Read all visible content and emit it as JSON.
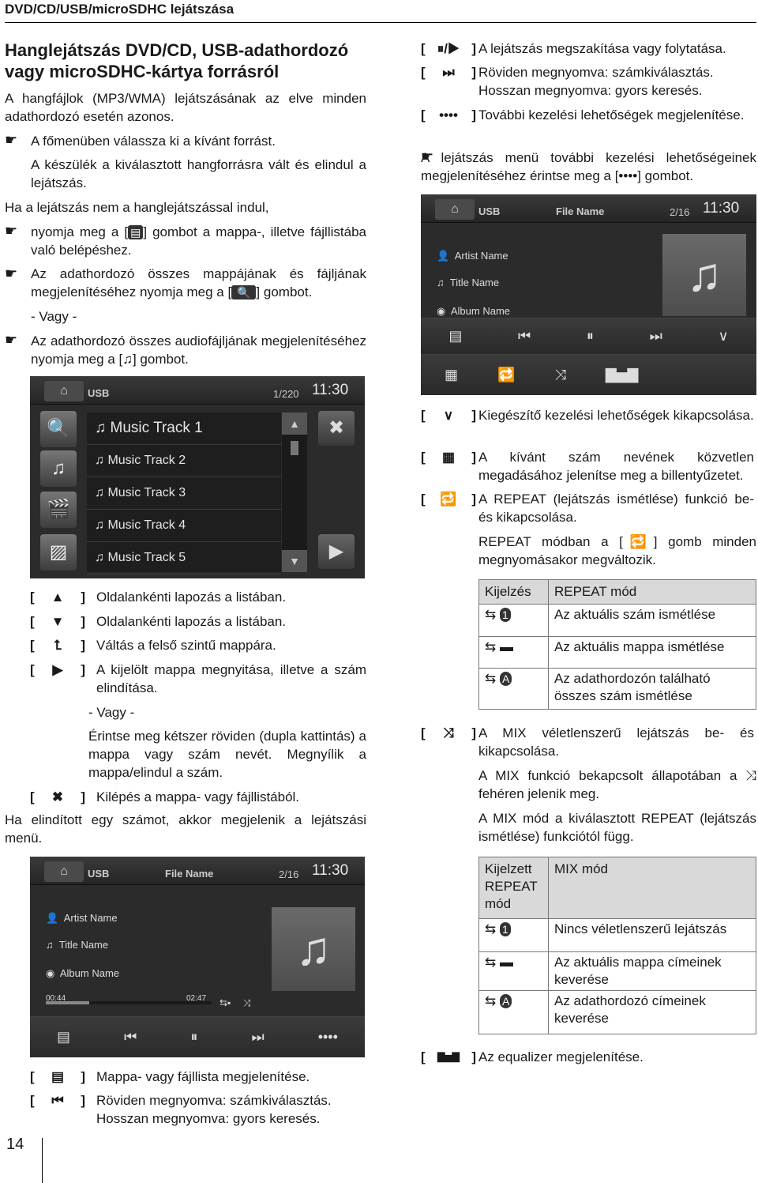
{
  "header": {
    "title": "DVD/CD/USB/microSDHC lejátszása"
  },
  "left": {
    "heading": "Hanglejátszás DVD/CD, USB-adathordozó vagy microSDHC-kártya forrásról",
    "intro": "A hangfájlok (MP3/WMA) lejátszásának az elve minden adathordozó esetén azonos.",
    "b1": "A főmenüben válassza ki a kívánt forrást.",
    "b1_note": "A készülék a kiválasztott hangforrásra vált és elindul a lejátszás.",
    "cond": "Ha a lejátszás nem a hanglejátszással indul,",
    "b2_a": "nyomja meg a [",
    "b2_b": "] gombot a mappa-, illetve fájllistába való belépéshez.",
    "b3_a": "Az adathordozó összes mappájának és fájljának megjelenítéséhez nyomja meg a [",
    "b3_b": "] gombot.",
    "or": "- Vagy -",
    "b4_a": "Az adathordozó összes audiofájljának megjelenítéséhez nyomja meg a [",
    "b4_b": "] gombot.",
    "keys": [
      {
        "icon": "▲",
        "text": "Oldalankénti lapozás a listában."
      },
      {
        "icon": "▼",
        "text": "Oldalankénti lapozás a listában."
      },
      {
        "icon": "⮤",
        "text": "Váltás a felső szintű mappára."
      },
      {
        "icon": "▶",
        "text": "A kijelölt mappa megnyitása, illetve a szám elindítása."
      },
      {
        "icon": "✖",
        "text": "Kilépés a mappa- vagy fájllistából."
      }
    ],
    "or2": "- Vagy -",
    "dbl": "Érintse meg kétszer röviden (dupla kattintás) a mappa vagy szám nevét. Megnyílik a mappa/elindul a szám.",
    "after": "Ha elindított egy számot, akkor megjelenik a lejátszási menü.",
    "keys2": [
      {
        "icon": "▤",
        "text": "Mappa- vagy fájllista megjelenítése."
      },
      {
        "icon": "⏮",
        "text": "Röviden megnyomva: számkiválasztás. Hosszan megnyomva: gyors keresés."
      }
    ]
  },
  "list_screen": {
    "source": "USB",
    "counter": "1/220",
    "clock": "11:30",
    "tracks": [
      "Music Track 1",
      "Music Track 2",
      "Music Track 3",
      "Music Track 4",
      "Music Track 5"
    ]
  },
  "player": {
    "source": "USB",
    "file": "File Name",
    "counter": "2/16",
    "clock": "11:30",
    "artist": "Artist Name",
    "title": "Title Name",
    "album": "Album Name",
    "elapsed": "00:44",
    "total": "02:47",
    "progress_percent": 26
  },
  "right": {
    "keys": [
      {
        "icon": "⏸/▶",
        "text": "A lejátszás megszakítása vagy folytatása."
      },
      {
        "icon": "⏭",
        "text": "Röviden megnyomva: számkiválasztás. Hosszan megnyomva: gyors keresés."
      },
      {
        "icon": "••••",
        "text": "További kezelési lehetőségek megjelenítése."
      }
    ],
    "bullet_a": "A lejátszás menü további kezelési lehetőségeinek megjelenítéséhez érintse meg a [",
    "bullet_b": "] gombot.",
    "keys2": [
      {
        "icon": "∨",
        "text": "Kiegészítő kezelési lehetőségek kikapcsolása."
      },
      {
        "icon": "▦",
        "text": "A kívánt szám nevének közvetlen megadásához jelenítse meg a billentyűzetet."
      },
      {
        "icon": "🔁",
        "text": "A REPEAT (lejátszás ismétlése) funkció be- és kikapcsolása."
      }
    ],
    "repeat_a": "REPEAT módban a [",
    "repeat_b": "] gomb minden megnyomásakor megváltozik.",
    "repeat_table": {
      "headers": [
        "Kijelzés",
        "REPEAT mód"
      ],
      "rows": [
        {
          "badge": "1",
          "text": "Az aktuális szám ismétlése"
        },
        {
          "badge": "▬",
          "text": "Az aktuális mappa ismétlése"
        },
        {
          "badge": "A",
          "text": "Az adathordozón található összes szám ismétlése"
        }
      ]
    },
    "mix_key": {
      "icon": "⤨",
      "text": "A MIX véletlenszerű lejátszás be- és kikapcsolása."
    },
    "mix_on_a": "A MIX funkció bekapcsolt állapotában a",
    "mix_on_b": "fehéren jelenik meg.",
    "mix_dep": "A MIX mód a kiválasztott REPEAT (lejátszás ismétlése) funkciótól függ.",
    "mix_table": {
      "headers": [
        "Kijelzett REPEAT mód",
        "MIX mód"
      ],
      "rows": [
        {
          "badge": "1",
          "text": "Nincs véletlenszerű lejátszás"
        },
        {
          "badge": "▬",
          "text": "Az aktuális mappa címeinek keverése"
        },
        {
          "badge": "A",
          "text": "Az adathordozó címeinek keverése"
        }
      ]
    },
    "eq_key": {
      "icon": "▇▅▇",
      "text": "Az equalizer megjelenítése."
    }
  },
  "page_number": "14"
}
